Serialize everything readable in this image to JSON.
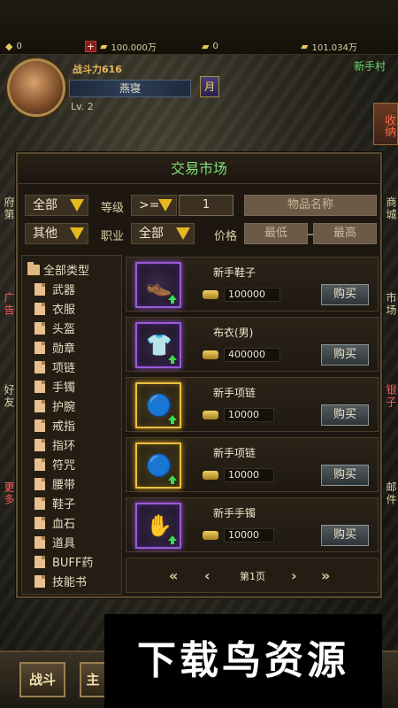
{
  "resources": [
    {
      "icon": "gem-icon",
      "value": "0"
    },
    {
      "icon": "gold-icon",
      "value": "100.000万"
    },
    {
      "icon": "gold-icon",
      "value": "0"
    },
    {
      "icon": "gold-icon",
      "value": "101.034万"
    }
  ],
  "player": {
    "power_text": "战斗力616",
    "name": "燕寝",
    "level": "Lv.  2",
    "moon_label": "月",
    "location": "新手村"
  },
  "side_tabs": {
    "shou_na": "收纳",
    "left": [
      "府第",
      "广告",
      "好友",
      "更多"
    ],
    "right": [
      "商城",
      "市场",
      "银子",
      "邮件"
    ]
  },
  "market": {
    "title": "交易市场",
    "filters": {
      "type_value": "全部",
      "level_label": "等级",
      "level_op": ">=",
      "level_value": "1",
      "name_placeholder": "物品名称",
      "sub_type_value": "其他",
      "class_label": "职业",
      "class_value": "全部",
      "price_label": "价格",
      "price_min_placeholder": "最低",
      "price_max_placeholder": "最高"
    },
    "categories_title": "全部类型",
    "categories": [
      "武器",
      "衣服",
      "头盔",
      "勋章",
      "项链",
      "手镯",
      "护腕",
      "戒指",
      "指环",
      "符咒",
      "腰带",
      "鞋子",
      "血石",
      "道具",
      "BUFF药",
      "技能书"
    ],
    "items": [
      {
        "name": "新手鞋子",
        "price": "100000",
        "frame": "purple",
        "glyph": "👞",
        "buy": "购买"
      },
      {
        "name": "布衣(男)",
        "price": "400000",
        "frame": "purple",
        "glyph": "👕",
        "buy": "购买"
      },
      {
        "name": "新手项链",
        "price": "10000",
        "frame": "gold",
        "glyph": "🔵",
        "buy": "购买"
      },
      {
        "name": "新手项链",
        "price": "10000",
        "frame": "gold",
        "glyph": "🔵",
        "buy": "购买"
      },
      {
        "name": "新手手镯",
        "price": "10000",
        "frame": "purple",
        "glyph": "✋",
        "buy": "购买"
      }
    ],
    "page_label": "第1页"
  },
  "bottom": {
    "battle": "战斗",
    "main": "主"
  },
  "watermark": "下载鸟资源"
}
